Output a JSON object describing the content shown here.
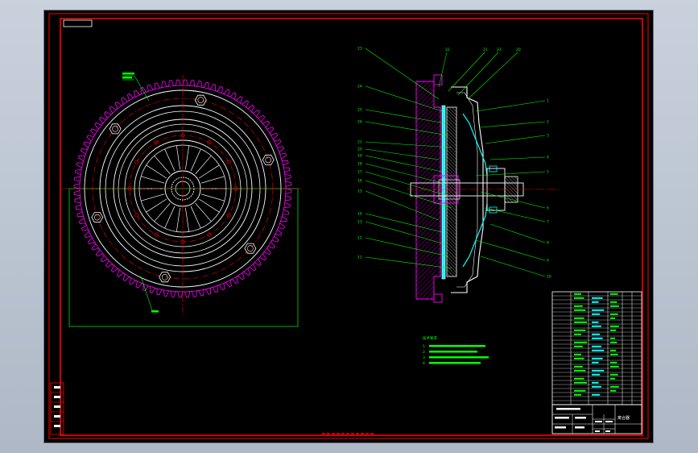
{
  "drawing": {
    "colors": {
      "background": "#000000",
      "frame": "#ff0000",
      "geometry": "#ffffff",
      "hidden": "#ff00ff",
      "leader": "#00ff00",
      "centerline": "#ff0000",
      "cyan": "#00ffff"
    },
    "front_view": {
      "gear_teeth": 92,
      "hub_spokes": 22
    },
    "section_view": {
      "balloons_left": [
        "23",
        "24",
        "25",
        "26",
        "21",
        "20",
        "19",
        "18",
        "17",
        "16",
        "15",
        "14",
        "13",
        "12",
        "11"
      ],
      "balloons_top": [
        "22",
        "21",
        "23",
        "20"
      ],
      "balloons_right": [
        "1",
        "2",
        "3",
        "4",
        "5",
        "6",
        "7",
        "8",
        "9",
        "10"
      ]
    },
    "technical_notes": {
      "heading": "技术要求",
      "items": [
        "1.",
        "2.",
        "3.",
        "4."
      ]
    },
    "title_block": {
      "title": "离合器"
    }
  }
}
